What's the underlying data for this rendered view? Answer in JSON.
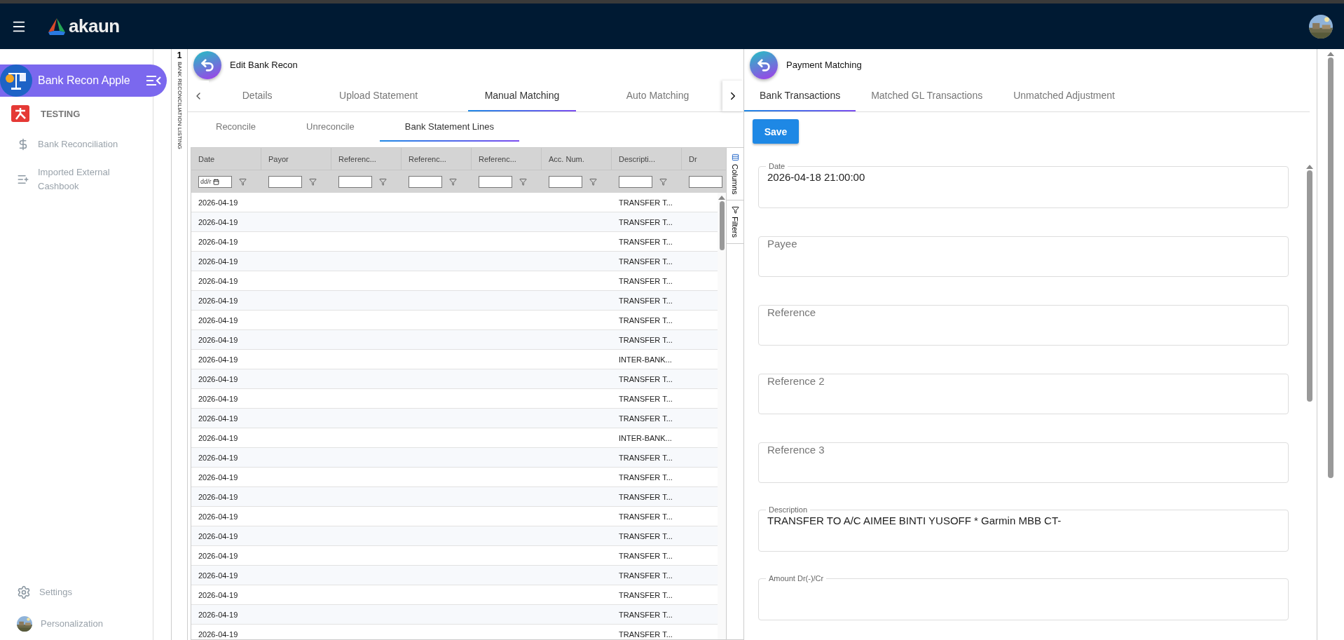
{
  "topbar": {
    "logo": "akaun"
  },
  "sidebar": {
    "app_title": "Bank Recon Apple",
    "org": "TESTING",
    "items": [
      {
        "label": "Bank Reconciliation"
      },
      {
        "label": "Imported External Cashbook"
      }
    ],
    "footer_items": [
      {
        "label": "Settings"
      },
      {
        "label": "Personalization"
      }
    ]
  },
  "listing_strip": {
    "count": "1",
    "label": "BANK RECONCILIATION LISTING"
  },
  "left_panel": {
    "title": "Edit Bank Recon",
    "tabs": [
      {
        "label": "Details",
        "selected": false
      },
      {
        "label": "Upload Statement",
        "selected": false
      },
      {
        "label": "Manual Matching",
        "selected": true
      },
      {
        "label": "Auto Matching",
        "selected": false
      }
    ],
    "sub_tabs": [
      {
        "label": "Reconcile",
        "selected": false
      },
      {
        "label": "Unreconcile",
        "selected": false
      },
      {
        "label": "Bank Statement Lines",
        "selected": true
      }
    ],
    "grid": {
      "columns": [
        {
          "label": "Date",
          "filter_placeholder": "dd/r"
        },
        {
          "label": "Payor"
        },
        {
          "label": "Referenc..."
        },
        {
          "label": "Referenc..."
        },
        {
          "label": "Referenc..."
        },
        {
          "label": "Acc. Num."
        },
        {
          "label": "Descripti..."
        },
        {
          "label": "Dr"
        }
      ],
      "side_buttons": [
        "Columns",
        "Filters"
      ],
      "rows": [
        {
          "date": "2026-04-19",
          "description": "TRANSFER T..."
        },
        {
          "date": "2026-04-19",
          "description": "TRANSFER T..."
        },
        {
          "date": "2026-04-19",
          "description": "TRANSFER T..."
        },
        {
          "date": "2026-04-19",
          "description": "TRANSFER T..."
        },
        {
          "date": "2026-04-19",
          "description": "TRANSFER T..."
        },
        {
          "date": "2026-04-19",
          "description": "TRANSFER T..."
        },
        {
          "date": "2026-04-19",
          "description": "TRANSFER T..."
        },
        {
          "date": "2026-04-19",
          "description": "TRANSFER T..."
        },
        {
          "date": "2026-04-19",
          "description": "INTER-BANK..."
        },
        {
          "date": "2026-04-19",
          "description": "TRANSFER T..."
        },
        {
          "date": "2026-04-19",
          "description": "TRANSFER T..."
        },
        {
          "date": "2026-04-19",
          "description": "TRANSFER T..."
        },
        {
          "date": "2026-04-19",
          "description": "INTER-BANK..."
        },
        {
          "date": "2026-04-19",
          "description": "TRANSFER T..."
        },
        {
          "date": "2026-04-19",
          "description": "TRANSFER T..."
        },
        {
          "date": "2026-04-19",
          "description": "TRANSFER T..."
        },
        {
          "date": "2026-04-19",
          "description": "TRANSFER T..."
        },
        {
          "date": "2026-04-19",
          "description": "TRANSFER T..."
        },
        {
          "date": "2026-04-19",
          "description": "TRANSFER T..."
        },
        {
          "date": "2026-04-19",
          "description": "TRANSFER T..."
        },
        {
          "date": "2026-04-19",
          "description": "TRANSFER T..."
        },
        {
          "date": "2026-04-19",
          "description": "TRANSFER T..."
        },
        {
          "date": "2026-04-19",
          "description": "TRANSFER T..."
        }
      ]
    }
  },
  "right_panel": {
    "title": "Payment Matching",
    "tabs": [
      {
        "label": "Bank Transactions",
        "selected": true
      },
      {
        "label": "Matched GL Transactions",
        "selected": false
      },
      {
        "label": "Unmatched Adjustment",
        "selected": false
      }
    ],
    "save_button": "Save",
    "fields": [
      {
        "label": "Date",
        "value": "2026-04-18 21:00:00"
      },
      {
        "placeholder": "Payee"
      },
      {
        "placeholder": "Reference"
      },
      {
        "placeholder": "Reference 2"
      },
      {
        "placeholder": "Reference 3"
      },
      {
        "label": "Description",
        "value": "TRANSFER TO A/C AIMEE BINTI YUSOFF * Garmin MBB CT-"
      },
      {
        "label": "Amount Dr(-)/Cr"
      }
    ]
  }
}
